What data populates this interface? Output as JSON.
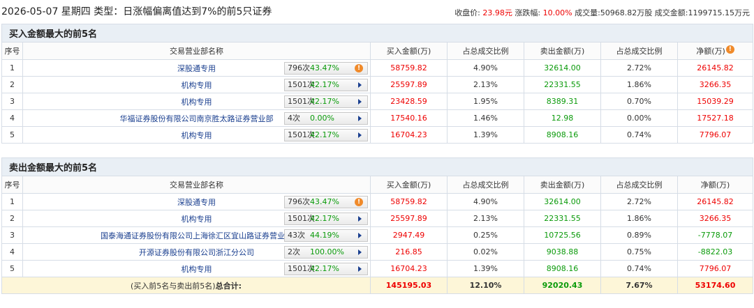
{
  "header": {
    "title": "2026-05-07 星期四 类型：日涨幅偏离值达到7%的前5只证券",
    "close_label": "收盘价:",
    "close_value": "23.98元",
    "change_label": "涨跌幅:",
    "change_value": "10.00%",
    "volume_label": "成交量:",
    "volume_value": "50968.82万股",
    "amount_label": "成交金额:",
    "amount_value": "1199715.15万元"
  },
  "columns": [
    "序号",
    "交易营业部名称",
    "买入金额(万)",
    "占总成交比例",
    "卖出金额(万)",
    "占总成交比例",
    "净额(万)",
    "净额(万)"
  ],
  "buy_section": {
    "title": "买入金额最大的前5名",
    "info_icon": "!",
    "rows": [
      {
        "idx": "1",
        "name": "深股通专用",
        "count": "796次",
        "rate": "43.47%",
        "icon": "warn",
        "buy": "58759.82",
        "buy_pct": "4.90%",
        "sell": "32614.00",
        "sell_pct": "2.72%",
        "net": "26145.82"
      },
      {
        "idx": "2",
        "name": "机构专用",
        "count": "1501次",
        "rate": "42.17%",
        "icon": "arrow",
        "buy": "25597.89",
        "buy_pct": "2.13%",
        "sell": "22331.55",
        "sell_pct": "1.86%",
        "net": "3266.35"
      },
      {
        "idx": "3",
        "name": "机构专用",
        "count": "1501次",
        "rate": "42.17%",
        "icon": "arrow",
        "buy": "23428.59",
        "buy_pct": "1.95%",
        "sell": "8389.31",
        "sell_pct": "0.70%",
        "net": "15039.29"
      },
      {
        "idx": "4",
        "name": "华福证券股份有限公司南京胜太路证券营业部",
        "count": "4次",
        "rate": "0.00%",
        "icon": "arrow",
        "buy": "17540.16",
        "buy_pct": "1.46%",
        "sell": "12.98",
        "sell_pct": "0.00%",
        "net": "17527.18"
      },
      {
        "idx": "5",
        "name": "机构专用",
        "count": "1501次",
        "rate": "42.17%",
        "icon": "arrow",
        "buy": "16704.23",
        "buy_pct": "1.39%",
        "sell": "8908.16",
        "sell_pct": "0.74%",
        "net": "7796.07"
      }
    ]
  },
  "sell_section": {
    "title": "卖出金额最大的前5名",
    "rows": [
      {
        "idx": "1",
        "name": "深股通专用",
        "count": "796次",
        "rate": "43.47%",
        "icon": "warn",
        "buy": "58759.82",
        "buy_pct": "4.90%",
        "sell": "32614.00",
        "sell_pct": "2.72%",
        "net": "26145.82"
      },
      {
        "idx": "2",
        "name": "机构专用",
        "count": "1501次",
        "rate": "42.17%",
        "icon": "arrow",
        "buy": "25597.89",
        "buy_pct": "2.13%",
        "sell": "22331.55",
        "sell_pct": "1.86%",
        "net": "3266.35"
      },
      {
        "idx": "3",
        "name": "国泰海通证券股份有限公司上海徐汇区宜山路证券营业部",
        "count": "43次",
        "rate": "44.19%",
        "icon": "arrow",
        "buy": "2947.49",
        "buy_pct": "0.25%",
        "sell": "10725.56",
        "sell_pct": "0.89%",
        "net": "-7778.07"
      },
      {
        "idx": "4",
        "name": "开源证券股份有限公司浙江分公司",
        "count": "2次",
        "rate": "100.00%",
        "icon": "arrow",
        "buy": "216.85",
        "buy_pct": "0.02%",
        "sell": "9038.88",
        "sell_pct": "0.75%",
        "net": "-8822.03"
      },
      {
        "idx": "5",
        "name": "机构专用",
        "count": "1501次",
        "rate": "42.17%",
        "icon": "arrow",
        "buy": "16704.23",
        "buy_pct": "1.39%",
        "sell": "8908.16",
        "sell_pct": "0.74%",
        "net": "7796.07"
      }
    ]
  },
  "total": {
    "label_prefix": "(买入前5名与卖出前5名)",
    "label_bold": "总合计:",
    "buy": "145195.03",
    "buy_pct": "12.10%",
    "sell": "92020.43",
    "sell_pct": "7.67%",
    "net": "53174.60"
  },
  "colors": {
    "positive": "#e00000",
    "negative": "#0a9a0a",
    "section_bg": "#e9eff5",
    "total_bg": "#fdf6d8"
  }
}
